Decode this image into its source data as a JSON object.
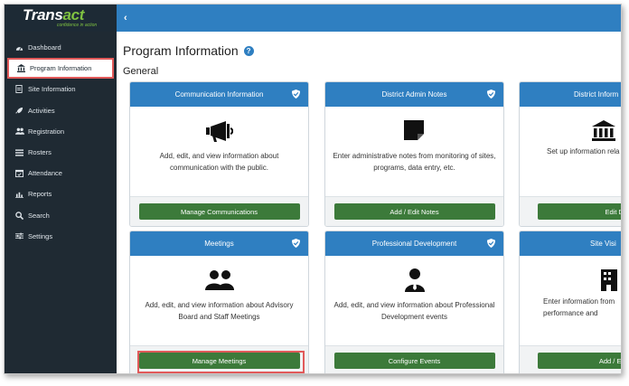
{
  "logo": {
    "brand_a": "Trans",
    "brand_b": "act",
    "tagline": "confidence in action"
  },
  "sidebar": {
    "items": [
      {
        "label": "Dashboard",
        "icon": "dashboard-icon"
      },
      {
        "label": "Program Information",
        "icon": "bank-icon",
        "active": true
      },
      {
        "label": "Site Information",
        "icon": "document-icon"
      },
      {
        "label": "Activities",
        "icon": "rocket-icon"
      },
      {
        "label": "Registration",
        "icon": "users-icon"
      },
      {
        "label": "Rosters",
        "icon": "list-icon"
      },
      {
        "label": "Attendance",
        "icon": "calendar-icon"
      },
      {
        "label": "Reports",
        "icon": "bar-chart-icon"
      },
      {
        "label": "Search",
        "icon": "search-icon"
      },
      {
        "label": "Settings",
        "icon": "sliders-icon"
      }
    ]
  },
  "topbar": {
    "collapse_glyph": "‹"
  },
  "main": {
    "title": "Program Information",
    "help_glyph": "?",
    "section": "General",
    "cards": [
      {
        "title": "Communication Information",
        "icon": "megaphone-icon",
        "desc": "Add, edit, and view information about communication with the public.",
        "button": "Manage Communications"
      },
      {
        "title": "District Admin Notes",
        "icon": "sticky-note-icon",
        "desc": "Enter administrative notes from monitoring of sites, programs, data entry, etc.",
        "button": "Add / Edit Notes"
      },
      {
        "title": "District Inform",
        "icon": "bank-icon",
        "desc": "Set up information rela",
        "button": "Edit Dist"
      },
      {
        "title": "Meetings",
        "icon": "users-icon",
        "desc": "Add, edit, and view information about Advisory Board and Staff Meetings",
        "button": "Manage Meetings"
      },
      {
        "title": "Professional Development",
        "icon": "user-tie-icon",
        "desc": "Add, edit, and view information about Professional Development events",
        "button": "Configure Events"
      },
      {
        "title": "Site Visi",
        "icon": "building-icon",
        "desc": "Enter information from performance and",
        "button": "Add / Edit Si"
      }
    ]
  },
  "colors": {
    "sidebar": "#1f2a33",
    "accent_blue": "#2f7fc1",
    "button_green": "#3c7a3a",
    "highlight": "#e15a5a",
    "brand_green": "#7fc241"
  }
}
